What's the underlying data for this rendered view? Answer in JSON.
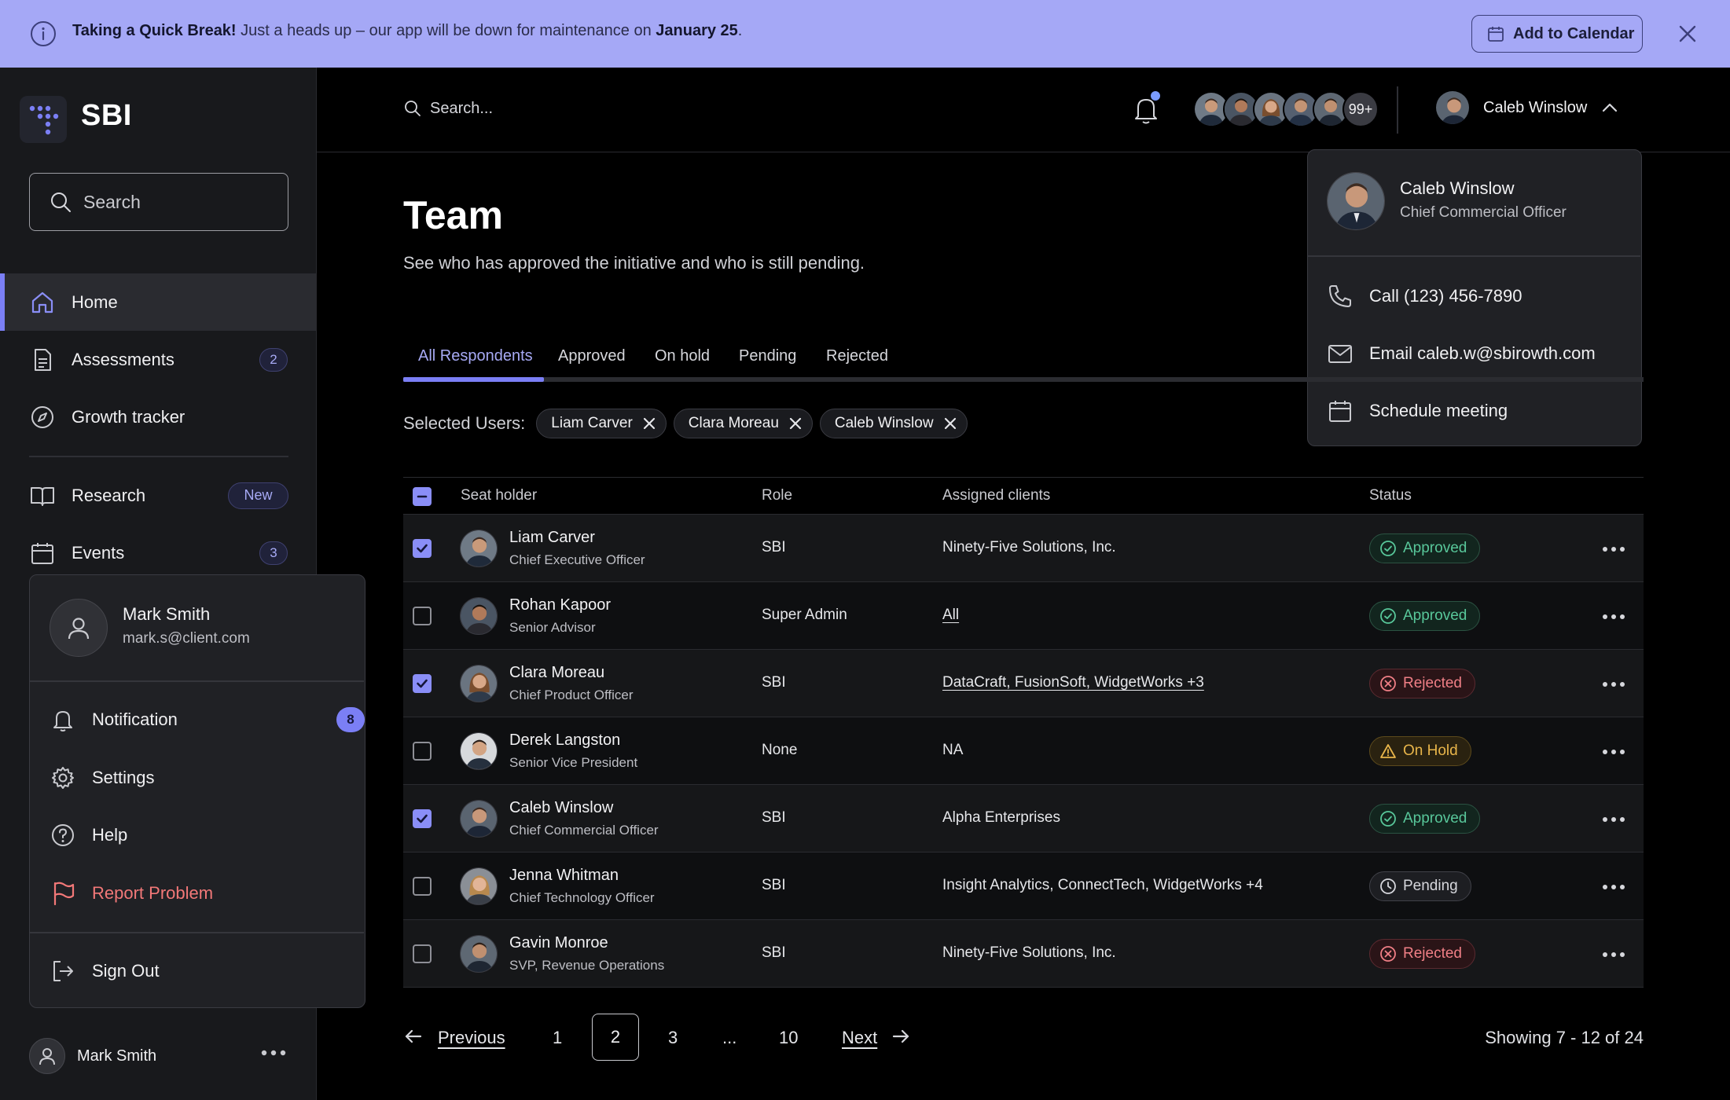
{
  "banner": {
    "title": "Taking a Quick Break!",
    "message": "Just a heads up – our app will be down for maintenance on",
    "date": "January 25",
    "period": ".",
    "add_to_calendar": "Add to Calendar"
  },
  "brand": {
    "name": "SBI"
  },
  "sidebar": {
    "search_placeholder": "Search",
    "items": [
      {
        "label": "Home",
        "icon": "home-icon",
        "active": true
      },
      {
        "label": "Assessments",
        "icon": "document-icon",
        "badge": "2"
      },
      {
        "label": "Growth tracker",
        "icon": "compass-icon"
      },
      {
        "label": "Research",
        "icon": "book-icon",
        "badge": "New"
      },
      {
        "label": "Events",
        "icon": "calendar-icon",
        "badge": "3"
      }
    ],
    "footer_name": "Mark Smith"
  },
  "user_menu": {
    "name": "Mark Smith",
    "email": "mark.s@client.com",
    "items": [
      {
        "label": "Notification",
        "icon": "bell-icon",
        "badge": "8"
      },
      {
        "label": "Settings",
        "icon": "gear-icon"
      },
      {
        "label": "Help",
        "icon": "help-icon"
      },
      {
        "label": "Report Problem",
        "icon": "flag-icon"
      }
    ],
    "sign_out": "Sign Out"
  },
  "topbar": {
    "search_placeholder": "Search...",
    "avatar_overflow": "99+",
    "current_user": "Caleb Winslow"
  },
  "profile_card": {
    "name": "Caleb Winslow",
    "title": "Chief Commercial Officer",
    "actions": [
      {
        "label": "Call (123) 456-7890",
        "icon": "phone-icon"
      },
      {
        "label": "Email caleb.w@sbirowth.com",
        "icon": "mail-icon"
      },
      {
        "label": "Schedule meeting",
        "icon": "calendar-icon"
      }
    ]
  },
  "page": {
    "title": "Team",
    "subtitle": "See who has approved the initiative and who is still pending."
  },
  "tabs": [
    "All Respondents",
    "Approved",
    "On hold",
    "Pending",
    "Rejected"
  ],
  "selected_users": {
    "label": "Selected Users:",
    "chips": [
      "Liam Carver",
      "Clara Moreau",
      "Caleb Winslow"
    ]
  },
  "table": {
    "headers": {
      "seat_holder": "Seat holder",
      "role": "Role",
      "clients": "Assigned clients",
      "status": "Status"
    },
    "rows": [
      {
        "name": "Liam Carver",
        "title": "Chief Executive Officer",
        "role": "SBI",
        "clients": "Ninety-Five Solutions, Inc.",
        "status": "Approved",
        "checked": true
      },
      {
        "name": "Rohan Kapoor",
        "title": "Senior Advisor",
        "role": "Super Admin",
        "clients": "All",
        "status": "Approved",
        "checked": false
      },
      {
        "name": "Clara Moreau",
        "title": "Chief Product Officer",
        "role": "SBI",
        "clients": "DataCraft, FusionSoft, WidgetWorks +3",
        "status": "Rejected",
        "checked": true
      },
      {
        "name": "Derek Langston",
        "title": "Senior Vice President",
        "role": "None",
        "clients": "NA",
        "status": "On Hold",
        "checked": false
      },
      {
        "name": "Caleb Winslow",
        "title": "Chief Commercial Officer",
        "role": "SBI",
        "clients": "Alpha Enterprises",
        "status": "Approved",
        "checked": true
      },
      {
        "name": "Jenna Whitman",
        "title": "Chief Technology Officer",
        "role": "SBI",
        "clients": "Insight Analytics, ConnectTech, WidgetWorks +4",
        "status": "Pending",
        "checked": false
      },
      {
        "name": "Gavin Monroe",
        "title": "SVP, Revenue Operations",
        "role": "SBI",
        "clients": "Ninety-Five Solutions, Inc.",
        "status": "Rejected",
        "checked": false
      }
    ]
  },
  "pagination": {
    "previous": "Previous",
    "pages": [
      "1",
      "2",
      "3",
      "...",
      "10"
    ],
    "current": "2",
    "next": "Next",
    "showing": "Showing 7 - 12 of 24"
  },
  "colors": {
    "accent": "#7B7FF5",
    "banner": "#A5A8F6",
    "approved": "#58C79A",
    "rejected": "#F07F86",
    "on_hold": "#E8B54A"
  }
}
